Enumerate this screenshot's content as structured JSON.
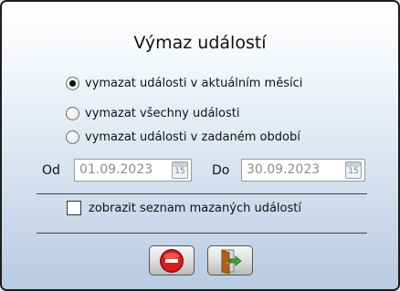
{
  "dialog": {
    "title": "Výmaz událostí",
    "options": [
      {
        "label": "vymazat události v aktuálním měsíci",
        "checked": true
      },
      {
        "label": "vymazat všechny události",
        "checked": false
      },
      {
        "label": "vymazat události v zadaném období",
        "checked": false
      }
    ],
    "from": {
      "label": "Od",
      "value": "01.09.2023",
      "calendar_day": "15"
    },
    "to": {
      "label": "Do",
      "value": "30.09.2023",
      "calendar_day": "15"
    },
    "show_list": {
      "label": "zobrazit seznam mazaných událostí",
      "checked": false
    },
    "buttons": {
      "delete": {
        "icon": "minus-circle-icon",
        "color": "#d21f1f"
      },
      "exit": {
        "icon": "exit-door-icon",
        "color": "#3ca43c"
      }
    }
  }
}
